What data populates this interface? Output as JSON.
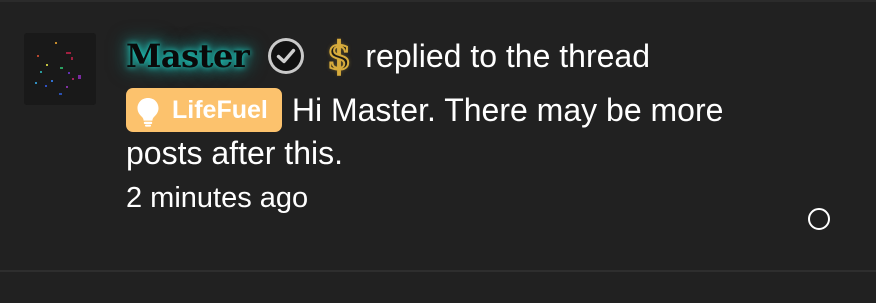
{
  "notification": {
    "username": "Master",
    "action_text": "replied to the thread",
    "badge": {
      "label": "LifeFuel",
      "color": "#fcc26d",
      "icon": "lightbulb-icon"
    },
    "message": "Hi Master. There may be more posts after this.",
    "timestamp": "2 minutes ago",
    "icons": {
      "verified": "verified-check-icon",
      "currency": "gold-dollar-icon",
      "read_state": "unread-circle-icon"
    },
    "colors": {
      "background": "#212121",
      "username_glow": "#1fd1c4",
      "dollar_gold": "#d7ab3c",
      "text": "#ffffff"
    }
  }
}
